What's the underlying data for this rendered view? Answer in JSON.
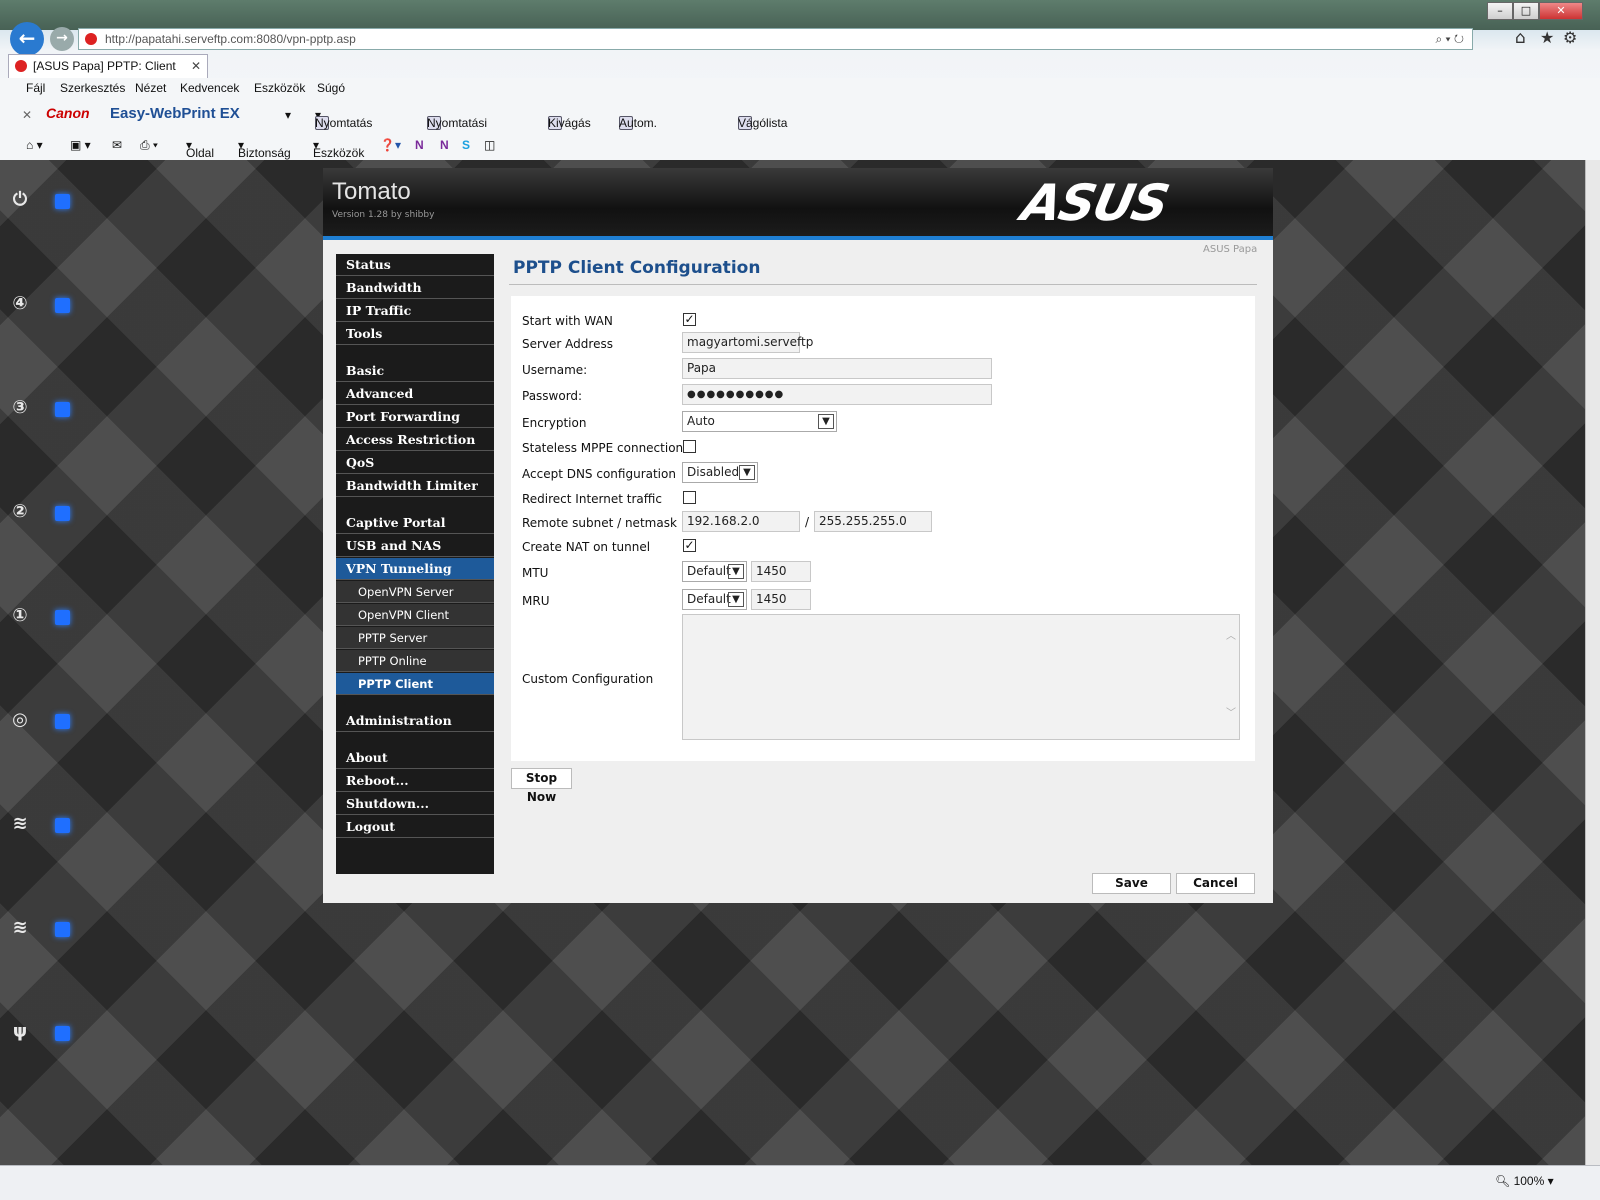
{
  "browser": {
    "url": "http://papatahi.serveftp.com:8080/vpn-pptp.asp",
    "tab_title": "[ASUS Papa] PPTP: Client",
    "menu": [
      "Fájl",
      "Szerkesztés",
      "Nézet",
      "Kedvencek",
      "Eszközök",
      "Súgó"
    ],
    "canon": {
      "brand": "Canon",
      "product": "Easy-WebPrint EX",
      "print": "Nyomtatás",
      "print_preview": "Nyomtatási kép",
      "clip": "Kivágás",
      "auto_clip": "Autom. kivágás",
      "clip_list": "Vágólista"
    },
    "commands": {
      "page": "Oldal",
      "security": "Biztonság",
      "tools": "Eszközök"
    },
    "zoom": "100%",
    "window": {
      "minimize": "–",
      "maximize": "□",
      "close": "✕"
    }
  },
  "router": {
    "name": "Tomato",
    "version": "Version 1.28 by shibby",
    "logo": "ASUS",
    "host": "ASUS Papa"
  },
  "sidebar": {
    "items": [
      {
        "label": "Status"
      },
      {
        "label": "Bandwidth"
      },
      {
        "label": "IP Traffic"
      },
      {
        "label": "Tools"
      },
      {
        "label": "Basic"
      },
      {
        "label": "Advanced"
      },
      {
        "label": "Port Forwarding"
      },
      {
        "label": "Access Restriction"
      },
      {
        "label": "QoS"
      },
      {
        "label": "Bandwidth Limiter"
      },
      {
        "label": "Captive Portal"
      },
      {
        "label": "USB and NAS"
      },
      {
        "label": "VPN Tunneling"
      },
      {
        "label": "OpenVPN Server"
      },
      {
        "label": "OpenVPN Client"
      },
      {
        "label": "PPTP Server"
      },
      {
        "label": "PPTP Online"
      },
      {
        "label": "PPTP Client"
      },
      {
        "label": "Administration"
      },
      {
        "label": "About"
      },
      {
        "label": "Reboot..."
      },
      {
        "label": "Shutdown..."
      },
      {
        "label": "Logout"
      }
    ]
  },
  "page": {
    "title": "PPTP Client Configuration",
    "fields": {
      "start_wan": {
        "label": "Start with WAN",
        "checked": "✓"
      },
      "server": {
        "label": "Server Address",
        "value": "magyartomi.serveftp"
      },
      "username": {
        "label": "Username:",
        "value": "Papa"
      },
      "password": {
        "label": "Password:",
        "value": "●●●●●●●●●●"
      },
      "encryption": {
        "label": "Encryption",
        "value": "Auto"
      },
      "stateless": {
        "label": "Stateless MPPE connection",
        "checked": ""
      },
      "dns": {
        "label": "Accept DNS configuration",
        "value": "Disabled"
      },
      "redirect": {
        "label": "Redirect Internet traffic",
        "checked": ""
      },
      "subnet": {
        "label": "Remote subnet / netmask",
        "ip": "192.168.2.0",
        "sep": "/",
        "mask": "255.255.255.0"
      },
      "nat": {
        "label": "Create NAT on tunnel",
        "checked": "✓"
      },
      "mtu": {
        "label": "MTU",
        "mode": "Default",
        "value": "1450"
      },
      "mru": {
        "label": "MRU",
        "mode": "Default",
        "value": "1450"
      },
      "custom": {
        "label": "Custom Configuration",
        "value": ""
      }
    },
    "buttons": {
      "stop": "Stop Now",
      "save": "Save",
      "cancel": "Cancel"
    }
  }
}
